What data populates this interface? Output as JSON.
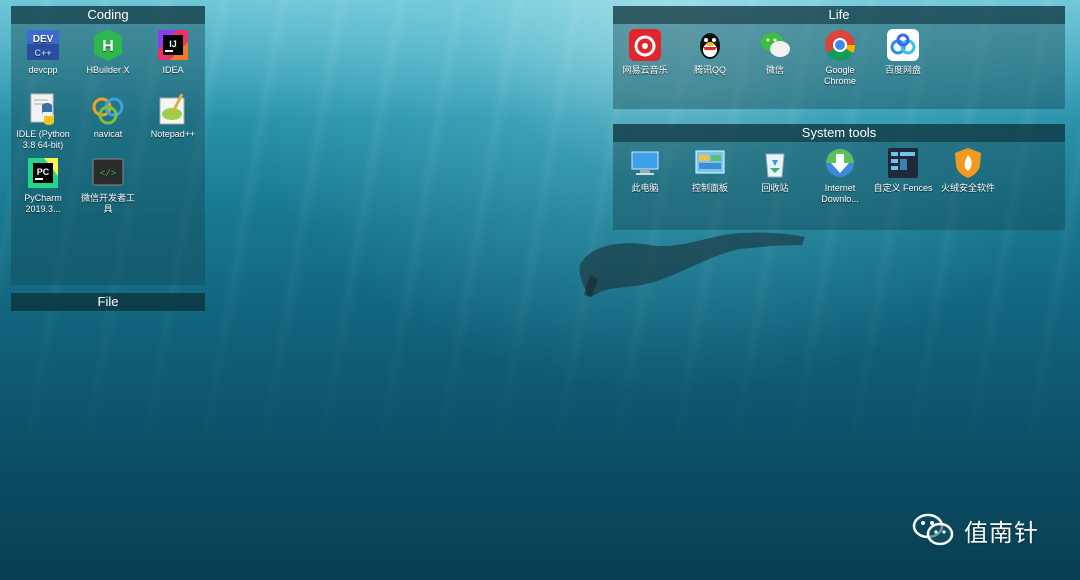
{
  "desktop": {
    "watermark": "值南针"
  },
  "fences": {
    "coding": {
      "title": "Coding",
      "items": [
        {
          "label": "devcpp",
          "icon": "devcpp-icon"
        },
        {
          "label": "HBuilder X",
          "icon": "hbuilder-icon"
        },
        {
          "label": "IDEA",
          "icon": "idea-icon"
        },
        {
          "label": "IDLE (Python 3.8 64-bit)",
          "icon": "python-idle-icon"
        },
        {
          "label": "navicat",
          "icon": "navicat-icon"
        },
        {
          "label": "Notepad++",
          "icon": "notepadpp-icon"
        },
        {
          "label": "PyCharm 2019.3...",
          "icon": "pycharm-icon"
        },
        {
          "label": "微信开发者工具",
          "icon": "wechat-devtools-icon"
        }
      ]
    },
    "file": {
      "title": "File"
    },
    "life": {
      "title": "Life",
      "items": [
        {
          "label": "网易云音乐",
          "icon": "netease-music-icon"
        },
        {
          "label": "腾讯QQ",
          "icon": "qq-icon"
        },
        {
          "label": "微信",
          "icon": "wechat-icon"
        },
        {
          "label": "Google Chrome",
          "icon": "chrome-icon"
        },
        {
          "label": "百度网盘",
          "icon": "baidu-netdisk-icon"
        }
      ]
    },
    "system_tools": {
      "title": "System tools",
      "items": [
        {
          "label": "此电脑",
          "icon": "this-pc-icon"
        },
        {
          "label": "控制面板",
          "icon": "control-panel-icon"
        },
        {
          "label": "回收站",
          "icon": "recycle-bin-icon"
        },
        {
          "label": "Internet Downlo...",
          "icon": "idm-icon"
        },
        {
          "label": "自定义 Fences",
          "icon": "fences-icon"
        },
        {
          "label": "火绒安全软件",
          "icon": "huorong-icon"
        }
      ]
    }
  }
}
